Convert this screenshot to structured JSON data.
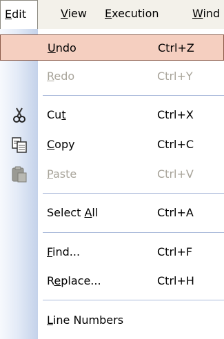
{
  "menubar": {
    "items": [
      {
        "mnemonic": "E",
        "rest": "dit"
      },
      {
        "mnemonic": "V",
        "rest": "iew"
      },
      {
        "mnemonic": "E",
        "rest": "xecution"
      },
      {
        "mnemonic": "W",
        "rest": "ind"
      }
    ]
  },
  "menu": {
    "undo": {
      "mnemonic": "U",
      "rest": "ndo",
      "shortcut": "Ctrl+Z"
    },
    "redo": {
      "mnemonic": "R",
      "rest": "edo",
      "shortcut": "Ctrl+Y"
    },
    "cut": {
      "pre": "Cu",
      "mnemonic": "t",
      "shortcut": "Ctrl+X",
      "icon": "scissors-icon"
    },
    "copy": {
      "mnemonic": "C",
      "rest": "opy",
      "shortcut": "Ctrl+C",
      "icon": "copy-icon"
    },
    "paste": {
      "mnemonic": "P",
      "rest": "aste",
      "shortcut": "Ctrl+V",
      "icon": "clipboard-icon"
    },
    "select_all": {
      "pre": "Select ",
      "mnemonic": "A",
      "rest": "ll",
      "shortcut": "Ctrl+A"
    },
    "find": {
      "mnemonic": "F",
      "rest": "ind...",
      "shortcut": "Ctrl+F"
    },
    "replace": {
      "pre": "R",
      "mnemonic": "e",
      "rest": "place...",
      "shortcut": "Ctrl+H"
    },
    "line_numbers": {
      "mnemonic": "L",
      "rest": "ine Numbers"
    }
  },
  "colors": {
    "highlight": "#f5cfc0",
    "disabled_text": "#a8a49a",
    "separator": "#a9b9da"
  }
}
